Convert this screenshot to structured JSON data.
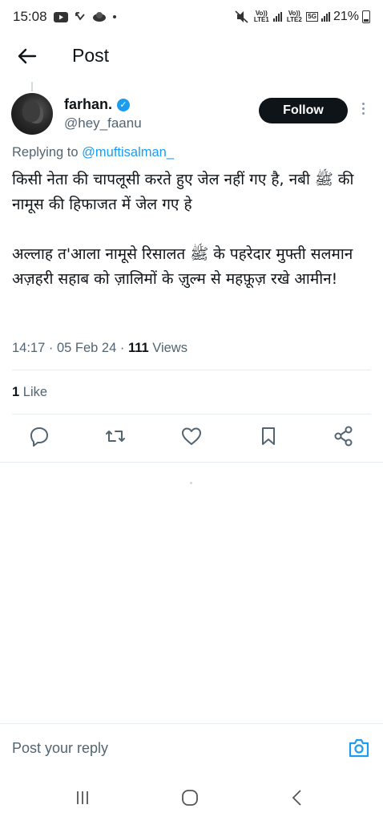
{
  "status_bar": {
    "time": "15:08",
    "battery": "21%",
    "sim1_label": "Vo)) LTE1",
    "sim2_label": "Vo)) LTE2",
    "network": "5G"
  },
  "header": {
    "title": "Post"
  },
  "author": {
    "name": "farhan.",
    "handle": "@hey_faanu",
    "follow_label": "Follow"
  },
  "post": {
    "replying_prefix": "Replying to",
    "replying_to": "@muftisalman_",
    "text": "किसी नेता की चापलूसी करते हुए जेल नहीं गए है, नबी ﷺ की नामूस की हिफाजत में जेल गए हे\n\nअल्लाह त'आला नामूसे रिसालत ﷺ के पहरेदार मुफ्ती सलमान अज़हरी सहाब को ज़ालिमों के ज़ुल्म से महफ़ूज़ रखे आमीन!",
    "timestamp": "14:17 · 05 Feb 24 · ",
    "views_count": "111",
    "views_label": "Views",
    "likes_count": "1",
    "likes_label": "Like"
  },
  "actions": [
    "reply-icon",
    "repost-icon",
    "like-icon",
    "bookmark-icon",
    "share-icon"
  ],
  "reply_bar": {
    "placeholder": "Post your reply"
  },
  "colors": {
    "accent": "#1d9bf0",
    "text": "#0f1419",
    "secondary": "#536471",
    "follow_bg": "#0f1419"
  }
}
